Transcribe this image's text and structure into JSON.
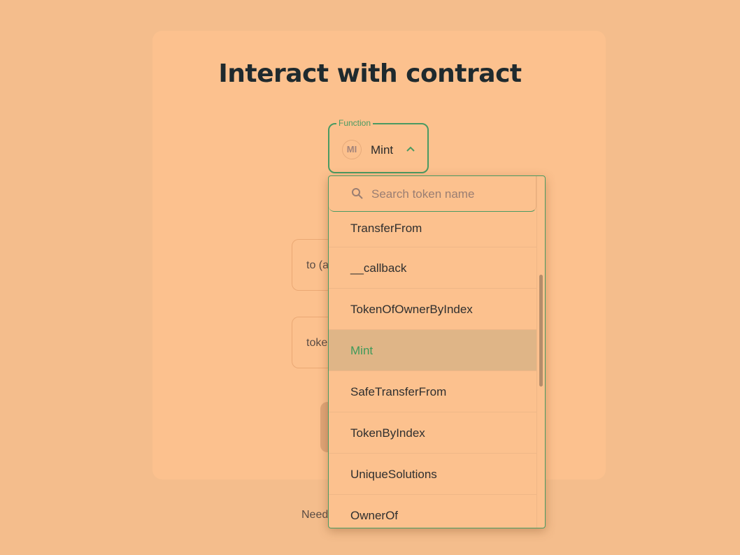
{
  "page": {
    "title": "Interact with contract",
    "footer_text": "Need"
  },
  "function_select": {
    "legend": "Function",
    "badge": "MI",
    "value": "Mint"
  },
  "fields": {
    "to_label": "to (address)",
    "token_label": "tokenId"
  },
  "dropdown": {
    "search_placeholder": "Search token name",
    "items": [
      {
        "label": "TransferFrom",
        "selected": false
      },
      {
        "label": "__callback",
        "selected": false
      },
      {
        "label": "TokenOfOwnerByIndex",
        "selected": false
      },
      {
        "label": "Mint",
        "selected": true
      },
      {
        "label": "SafeTransferFrom",
        "selected": false
      },
      {
        "label": "TokenByIndex",
        "selected": false
      },
      {
        "label": "UniqueSolutions",
        "selected": false
      },
      {
        "label": "OwnerOf",
        "selected": false
      }
    ]
  },
  "colors": {
    "background": "#f4bd8c",
    "card": "#fcc18e",
    "accent": "#4a9a62",
    "selected_row": "#dfb587"
  },
  "icons": {
    "chevron": "chevron-up-icon",
    "search": "search-icon"
  }
}
